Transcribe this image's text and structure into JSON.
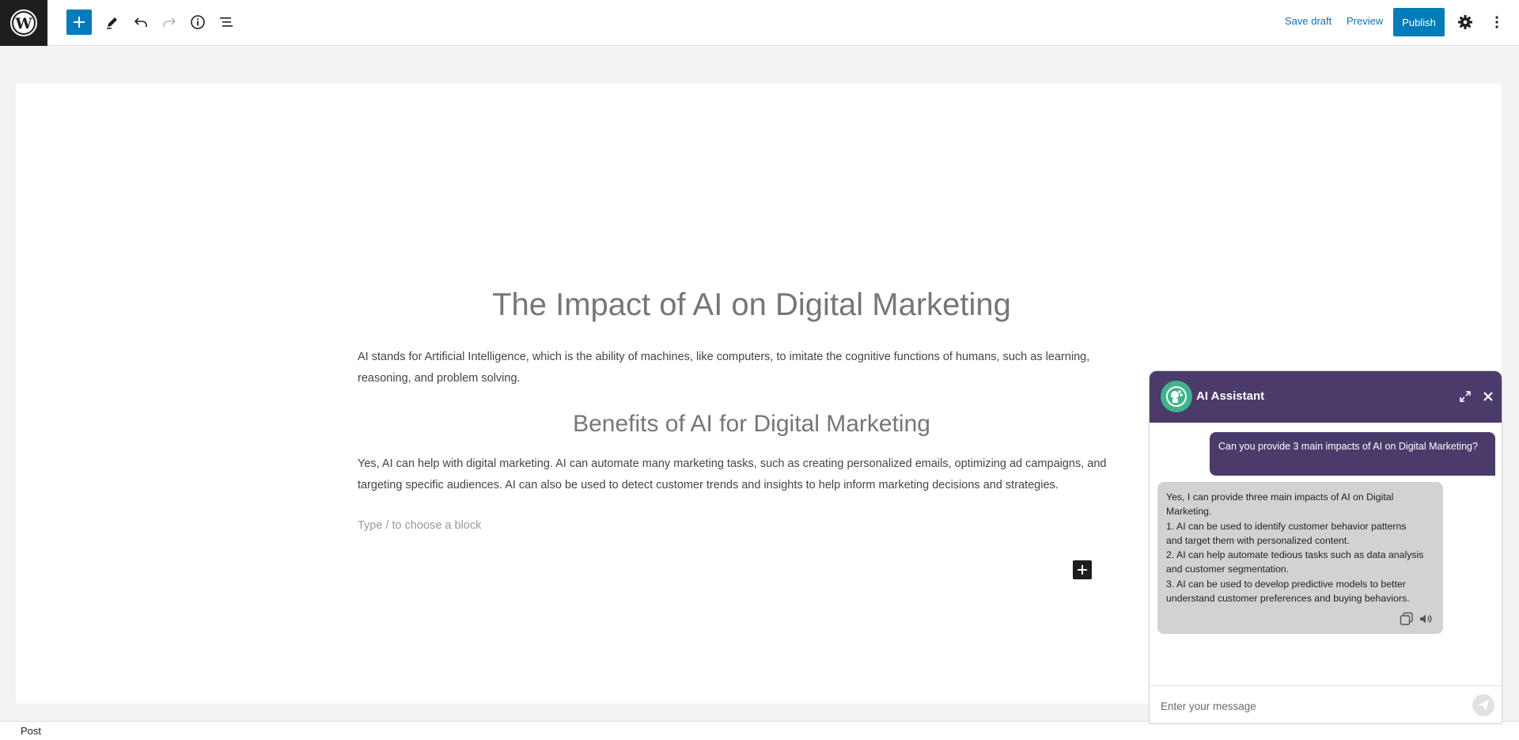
{
  "toolbar": {
    "logo_icon": "wordpress-logo-icon",
    "add_icon": "plus-icon",
    "edit_icon": "pencil-icon",
    "undo_icon": "undo-icon",
    "redo_icon": "redo-icon",
    "info_icon": "info-icon",
    "outline_icon": "list-view-icon",
    "save_draft_label": "Save draft",
    "preview_label": "Preview",
    "publish_label": "Publish",
    "settings_icon": "gear-icon",
    "more_icon": "kebab-icon"
  },
  "editor": {
    "title": "The Impact of AI on Digital Marketing",
    "paragraph1": "AI stands for Artificial Intelligence, which is the ability of machines, like computers, to imitate the cognitive functions of humans, such as learning, reasoning, and problem solving.",
    "heading2": "Benefits of AI for Digital Marketing",
    "paragraph2": "Yes, AI can help with digital marketing. AI can automate many marketing tasks, such as creating personalized emails, optimizing ad campaigns, and targeting specific audiences. AI can also be used to detect customer trends and insights to help inform marketing decisions and strategies.",
    "block_placeholder": "Type / to choose a block"
  },
  "status": {
    "label": "Post"
  },
  "assistant": {
    "title": "AI Assistant",
    "user_message": "Can you provide 3 main impacts of AI on Digital Marketing?",
    "ai_lines": [
      "Yes, I can provide three main impacts of AI on Digital",
      "Marketing.",
      "1. AI can be used to identify customer behavior patterns",
      "and target them with personalized content.",
      "2. AI can help automate tedious tasks such as data analysis",
      "and customer segmentation.",
      "3. AI can be used to develop predictive models to better",
      "understand customer preferences and buying behaviors."
    ],
    "input_placeholder": "Enter your message",
    "colors": {
      "header": "#4a3b6b",
      "avatar": "#3fb38a",
      "ai_bubble": "#d2d2d2"
    }
  },
  "colors": {
    "accent": "#007cba",
    "dark": "#1e1e1e"
  }
}
